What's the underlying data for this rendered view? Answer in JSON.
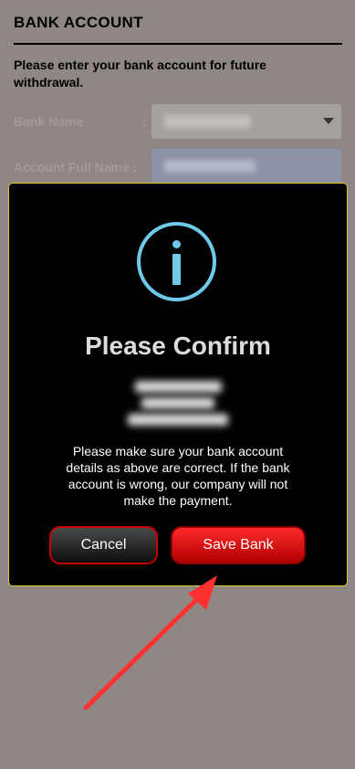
{
  "page": {
    "title": "BANK ACCOUNT",
    "intro": "Please enter your bank account for future withdrawal."
  },
  "form": {
    "bank_name_label": "Bank Name",
    "colon": ":",
    "account_name_label": "Account Full Name :"
  },
  "modal": {
    "icon": "info-icon",
    "title": "Please Confirm",
    "message": "Please make sure your bank account details as above are correct. If the bank account is wrong, our company will not make the payment.",
    "cancel_label": "Cancel",
    "save_label": "Save Bank"
  },
  "colors": {
    "backdrop": "#8f8785",
    "modal_bg": "#000000",
    "modal_border": "#d9c12f",
    "icon": "#6fc9e8",
    "save_button": "#e30000",
    "arrow": "#ff3030"
  }
}
